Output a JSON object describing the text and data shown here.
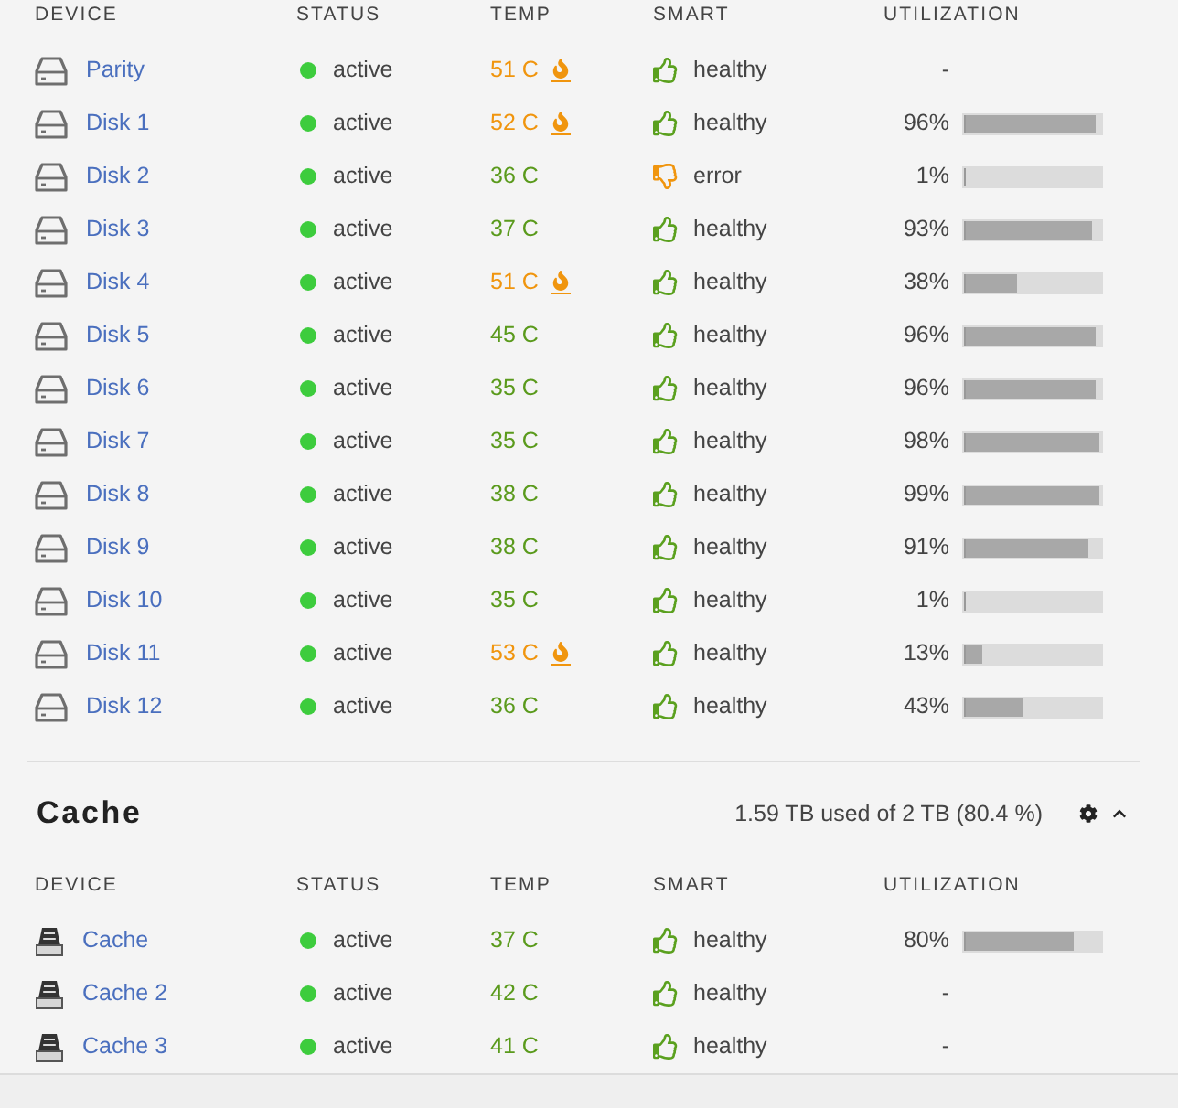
{
  "sections": [
    {
      "kind": "array",
      "columns": [
        "DEVICE",
        "STATUS",
        "TEMP",
        "SMART",
        "UTILIZATION"
      ],
      "rows": [
        {
          "name": "Parity",
          "status": "active",
          "temp": "51 C",
          "hot": true,
          "smart": "healthy",
          "smart_ok": true,
          "utilization": "-"
        },
        {
          "name": "Disk 1",
          "status": "active",
          "temp": "52 C",
          "hot": true,
          "smart": "healthy",
          "smart_ok": true,
          "utilization": "96%",
          "level": 0.96
        },
        {
          "name": "Disk 2",
          "status": "active",
          "temp": "36 C",
          "hot": false,
          "smart": "error",
          "smart_ok": false,
          "utilization": "1%",
          "level": 0.01
        },
        {
          "name": "Disk 3",
          "status": "active",
          "temp": "37 C",
          "hot": false,
          "smart": "healthy",
          "smart_ok": true,
          "utilization": "93%",
          "level": 0.93
        },
        {
          "name": "Disk 4",
          "status": "active",
          "temp": "51 C",
          "hot": true,
          "smart": "healthy",
          "smart_ok": true,
          "utilization": "38%",
          "level": 0.38
        },
        {
          "name": "Disk 5",
          "status": "active",
          "temp": "45 C",
          "hot": false,
          "smart": "healthy",
          "smart_ok": true,
          "utilization": "96%",
          "level": 0.96
        },
        {
          "name": "Disk 6",
          "status": "active",
          "temp": "35 C",
          "hot": false,
          "smart": "healthy",
          "smart_ok": true,
          "utilization": "96%",
          "level": 0.96
        },
        {
          "name": "Disk 7",
          "status": "active",
          "temp": "35 C",
          "hot": false,
          "smart": "healthy",
          "smart_ok": true,
          "utilization": "98%",
          "level": 0.98
        },
        {
          "name": "Disk 8",
          "status": "active",
          "temp": "38 C",
          "hot": false,
          "smart": "healthy",
          "smart_ok": true,
          "utilization": "99%",
          "level": 0.99
        },
        {
          "name": "Disk 9",
          "status": "active",
          "temp": "38 C",
          "hot": false,
          "smart": "healthy",
          "smart_ok": true,
          "utilization": "91%",
          "level": 0.91
        },
        {
          "name": "Disk 10",
          "status": "active",
          "temp": "35 C",
          "hot": false,
          "smart": "healthy",
          "smart_ok": true,
          "utilization": "1%",
          "level": 0.01
        },
        {
          "name": "Disk 11",
          "status": "active",
          "temp": "53 C",
          "hot": true,
          "smart": "healthy",
          "smart_ok": true,
          "utilization": "13%",
          "level": 0.13
        },
        {
          "name": "Disk 12",
          "status": "active",
          "temp": "36 C",
          "hot": false,
          "smart": "healthy",
          "smart_ok": true,
          "utilization": "43%",
          "level": 0.43
        }
      ]
    },
    {
      "kind": "pool",
      "title": "Cache",
      "summary": "1.59 TB used of 2 TB (80.4 %)",
      "expanded": true,
      "columns": [
        "DEVICE",
        "STATUS",
        "TEMP",
        "SMART",
        "UTILIZATION"
      ],
      "rows": [
        {
          "name": "Cache",
          "status": "active",
          "temp": "37 C",
          "hot": false,
          "smart": "healthy",
          "smart_ok": true,
          "utilization": "80%",
          "level": 0.8
        },
        {
          "name": "Cache 2",
          "status": "active",
          "temp": "42 C",
          "hot": false,
          "smart": "healthy",
          "smart_ok": true,
          "utilization": "-"
        },
        {
          "name": "Cache 3",
          "status": "active",
          "temp": "41 C",
          "hot": false,
          "smart": "healthy",
          "smart_ok": true,
          "utilization": "-"
        }
      ]
    }
  ]
}
